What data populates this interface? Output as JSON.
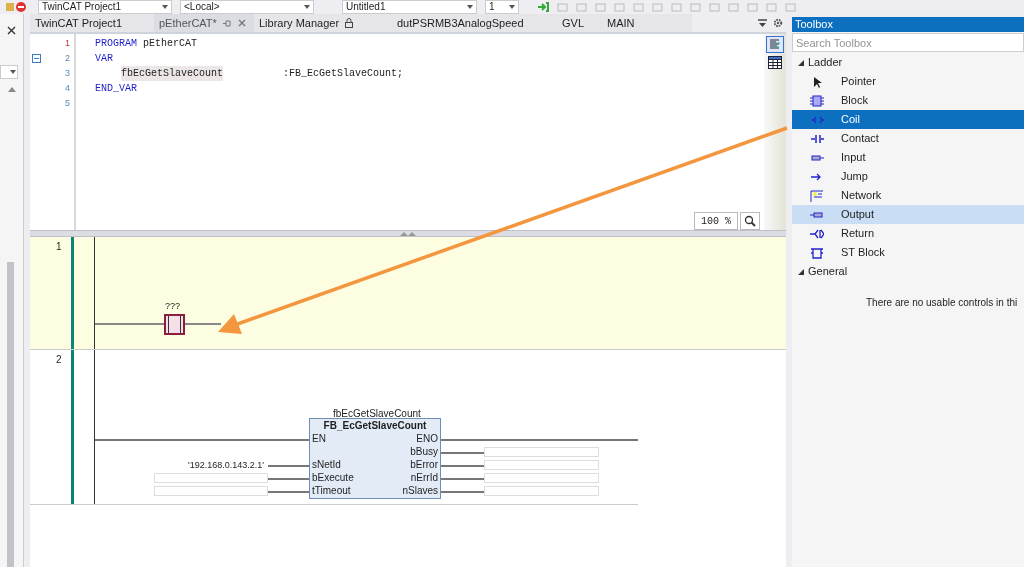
{
  "toolbar": {
    "dropdowns": [
      {
        "value": "TwinCAT Project1"
      },
      {
        "value": "<Local>"
      },
      {
        "value": "Untitled1"
      },
      {
        "value": "1"
      }
    ]
  },
  "tabs": [
    {
      "label": "TwinCAT Project1",
      "selected": false,
      "locked": false
    },
    {
      "label": "pEtherCAT*",
      "selected": true,
      "locked": false
    },
    {
      "label": "Library Manager",
      "selected": false,
      "locked": true
    },
    {
      "label": "dutPSRMB3AnalogSpeed",
      "selected": false,
      "locked": false
    },
    {
      "label": "GVL",
      "selected": false,
      "locked": false
    },
    {
      "label": "MAIN",
      "selected": false,
      "locked": false
    }
  ],
  "editor": {
    "lines": [
      {
        "number": "1",
        "current": true,
        "foldable": false,
        "tokens": [
          {
            "text": "PROGRAM",
            "kind": "keyword"
          },
          {
            "text": "pEtherCAT",
            "kind": "name"
          }
        ]
      },
      {
        "number": "2",
        "current": false,
        "foldable": true,
        "tokens": [
          {
            "text": "VAR",
            "kind": "keyword"
          }
        ]
      },
      {
        "number": "3",
        "current": false,
        "foldable": false,
        "tokens": [
          {
            "text": "fbEcGetSlaveCount",
            "kind": "highlight"
          },
          {
            "text": ":FB_EcGetSlaveCount;",
            "kind": "type"
          }
        ]
      },
      {
        "number": "4",
        "current": false,
        "foldable": false,
        "tokens": [
          {
            "text": "END_VAR",
            "kind": "keyword"
          }
        ]
      },
      {
        "number": "5",
        "current": false,
        "foldable": false
      }
    ],
    "zoom": "100 %"
  },
  "ladder": {
    "networks": [
      {
        "number": "1",
        "selected": true,
        "coil": {
          "label": "???"
        }
      },
      {
        "number": "2",
        "selected": false,
        "block": {
          "instance": "fbEcGetSlaveCount",
          "type": "FB_EcGetSlaveCount",
          "pins": [
            {
              "input": "EN",
              "output": "ENO"
            },
            {
              "output": "bBusy"
            },
            {
              "input": "sNetId",
              "input_value": "'192.168.0.143.2.1'",
              "output": "bError"
            },
            {
              "input": "bExecute",
              "output": "nErrId"
            },
            {
              "input": "tTimeout",
              "output": "nSlaves"
            }
          ]
        }
      }
    ]
  },
  "toolbox": {
    "title": "Toolbox",
    "search": {
      "placeholder": "Search Toolbox"
    },
    "groups": [
      {
        "label": "Ladder",
        "expanded": true,
        "items": [
          {
            "label": "Pointer",
            "selected": false,
            "hovered": false
          },
          {
            "label": "Block",
            "selected": false,
            "hovered": false
          },
          {
            "label": "Coil",
            "selected": true,
            "hovered": false
          },
          {
            "label": "Contact",
            "selected": false,
            "hovered": false
          },
          {
            "label": "Input",
            "selected": false,
            "hovered": false
          },
          {
            "label": "Jump",
            "selected": false,
            "hovered": false
          },
          {
            "label": "Network",
            "selected": false,
            "hovered": false
          },
          {
            "label": "Output",
            "selected": false,
            "hovered": true
          },
          {
            "label": "Return",
            "selected": false,
            "hovered": false
          },
          {
            "label": "ST Block",
            "selected": false,
            "hovered": false
          }
        ]
      },
      {
        "label": "General",
        "expanded": true,
        "message": "There are no usable controls in thi"
      }
    ]
  }
}
